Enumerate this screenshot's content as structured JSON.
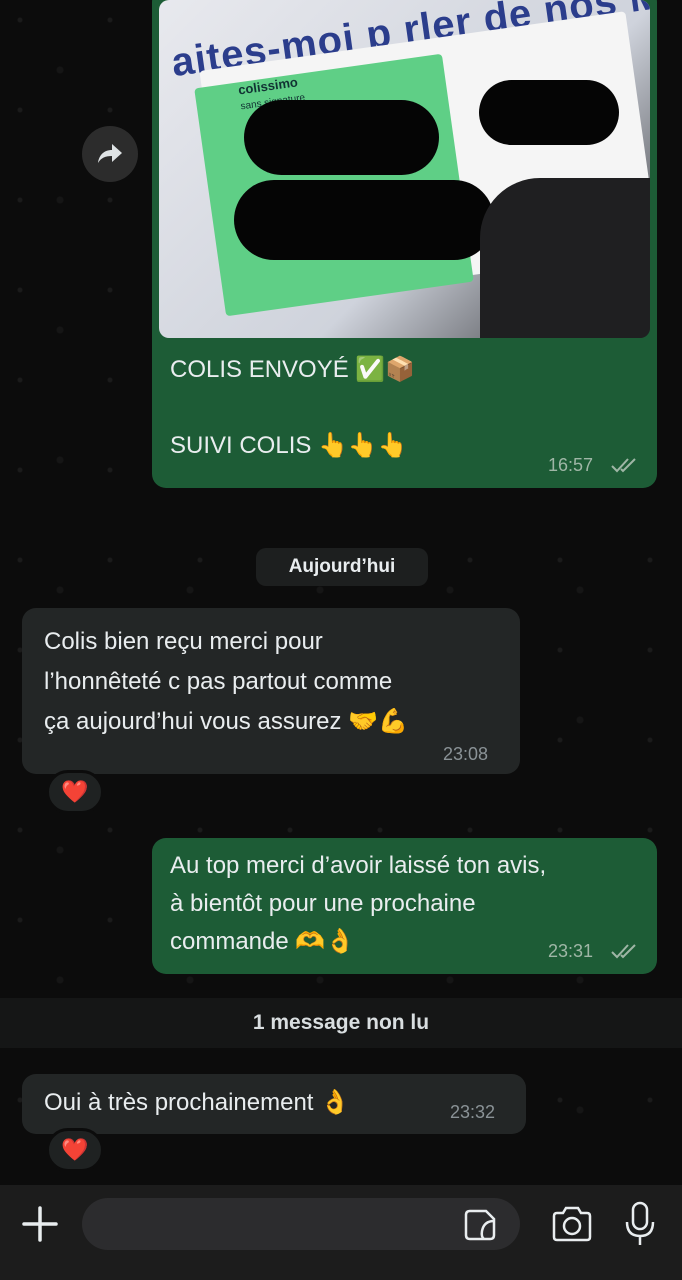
{
  "messages": {
    "sent_image": {
      "photo_text": {
        "poster": "aites-moi p   rler de nos  Mobile",
        "brand": "colissimo",
        "brand_sub": "sans signature"
      },
      "line1": "COLIS ENVOYÉ ✅📦",
      "line2": "SUIVI COLIS 👆👆👆",
      "time": "16:57"
    },
    "date_separator": "Aujourd’hui",
    "received_1": {
      "lines": [
        "Colis bien reçu merci pour",
        "l’honnêteté c pas partout comme",
        "ça aujourd’hui vous assurez 🤝💪"
      ],
      "time": "23:08",
      "reaction": "❤️"
    },
    "sent_2": {
      "lines": [
        "Au top merci d’avoir laissé ton avis,",
        "à bientôt pour une prochaine",
        "commande 🫶👌"
      ],
      "time": "23:31"
    },
    "unread_label": "1 message non lu",
    "received_2": {
      "text": "Oui à très prochainement 👌",
      "time": "23:32",
      "reaction": "❤️"
    }
  },
  "composer": {
    "placeholder": ""
  },
  "icons": {
    "forward": "forward-icon",
    "read_ticks": "double-check-icon",
    "add": "plus-icon",
    "sticker": "sticker-icon",
    "camera": "camera-icon",
    "mic": "microphone-icon"
  },
  "colors": {
    "outgoing_bubble": "#1d5c36",
    "incoming_bubble": "#232626",
    "background": "#0c0c0c",
    "reaction_heart": "#e0245e"
  }
}
